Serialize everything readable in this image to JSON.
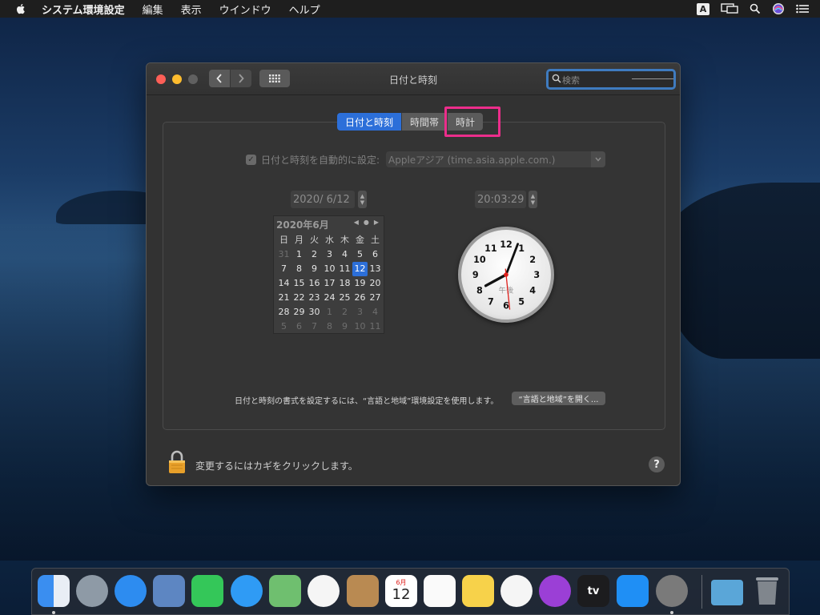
{
  "menubar": {
    "app_name": "システム環境設定",
    "items": [
      "編集",
      "表示",
      "ウインドウ",
      "ヘルプ"
    ],
    "input_indicator": "A"
  },
  "window": {
    "title": "日付と時刻",
    "search_placeholder": "検索",
    "tabs": [
      {
        "label": "日付と時刻",
        "active": true
      },
      {
        "label": "時間帯",
        "active": false
      },
      {
        "label": "時計",
        "active": false
      }
    ],
    "auto_set_label": "日付と時刻を自動的に設定:",
    "auto_set_checked": true,
    "time_server": "Appleアジア (time.asia.apple.com.)",
    "date_value": "2020/  6/12",
    "time_value": "20:03:29",
    "calendar": {
      "month_label": "2020年6月",
      "weekdays": [
        "日",
        "月",
        "火",
        "水",
        "木",
        "金",
        "土"
      ],
      "weeks": [
        [
          {
            "d": "31",
            "dim": true
          },
          {
            "d": "1"
          },
          {
            "d": "2"
          },
          {
            "d": "3"
          },
          {
            "d": "4"
          },
          {
            "d": "5"
          },
          {
            "d": "6"
          }
        ],
        [
          {
            "d": "7"
          },
          {
            "d": "8"
          },
          {
            "d": "9"
          },
          {
            "d": "10"
          },
          {
            "d": "11"
          },
          {
            "d": "12",
            "today": true
          },
          {
            "d": "13"
          }
        ],
        [
          {
            "d": "14"
          },
          {
            "d": "15"
          },
          {
            "d": "16"
          },
          {
            "d": "17"
          },
          {
            "d": "18"
          },
          {
            "d": "19"
          },
          {
            "d": "20"
          }
        ],
        [
          {
            "d": "21"
          },
          {
            "d": "22"
          },
          {
            "d": "23"
          },
          {
            "d": "24"
          },
          {
            "d": "25"
          },
          {
            "d": "26"
          },
          {
            "d": "27"
          }
        ],
        [
          {
            "d": "28"
          },
          {
            "d": "29"
          },
          {
            "d": "30"
          },
          {
            "d": "1",
            "dim": true
          },
          {
            "d": "2",
            "dim": true
          },
          {
            "d": "3",
            "dim": true
          },
          {
            "d": "4",
            "dim": true
          }
        ],
        [
          {
            "d": "5",
            "dim": true
          },
          {
            "d": "6",
            "dim": true
          },
          {
            "d": "7",
            "dim": true
          },
          {
            "d": "8",
            "dim": true
          },
          {
            "d": "9",
            "dim": true
          },
          {
            "d": "10",
            "dim": true
          },
          {
            "d": "11",
            "dim": true
          }
        ]
      ]
    },
    "clock": {
      "numerals": [
        "12",
        "1",
        "2",
        "3",
        "4",
        "5",
        "6",
        "7",
        "8",
        "9",
        "10",
        "11"
      ],
      "ampm_label": "午後",
      "hours": 20,
      "minutes": 3,
      "seconds": 29
    },
    "format_text": "日付と時刻の書式を設定するには、“言語と地域”環境設定を使用します。",
    "format_button": "“言語と地域”を開く...",
    "lock_text": "変更するにはカギをクリックします。",
    "help_label": "?"
  },
  "dock": {
    "apps": [
      {
        "icon": "finder-icon",
        "color": "#3a8ef0",
        "running": true
      },
      {
        "icon": "launchpad-icon",
        "color": "#8e9aa6",
        "running": false
      },
      {
        "icon": "safari-icon",
        "color": "#2d8cf0",
        "running": false
      },
      {
        "icon": "mail-icon",
        "color": "#5d86c2",
        "running": false
      },
      {
        "icon": "facetime-icon",
        "color": "#34c759",
        "running": false
      },
      {
        "icon": "messages-icon",
        "color": "#2f9bf5",
        "running": false
      },
      {
        "icon": "maps-icon",
        "color": "#6fbf6f",
        "running": false
      },
      {
        "icon": "photos-icon",
        "color": "#f5f5f5",
        "running": false
      },
      {
        "icon": "contacts-icon",
        "color": "#b98a52",
        "running": false
      },
      {
        "icon": "calendar-icon",
        "color": "#ffffff",
        "running": false,
        "month": "6月",
        "day": "12"
      },
      {
        "icon": "reminders-icon",
        "color": "#fafafa",
        "running": false
      },
      {
        "icon": "notes-icon",
        "color": "#f7d24a",
        "running": false
      },
      {
        "icon": "music-icon",
        "color": "#f5f5f5",
        "running": false
      },
      {
        "icon": "podcasts-icon",
        "color": "#9b3fd6",
        "running": false
      },
      {
        "icon": "appletv-icon",
        "color": "#1c1c1e",
        "running": false,
        "label": "tv"
      },
      {
        "icon": "appstore-icon",
        "color": "#1f8ff5",
        "running": false
      },
      {
        "icon": "system-preferences-icon",
        "color": "#7a7a7a",
        "running": true
      },
      {
        "icon": "downloads-folder-icon",
        "color": "#5aa6d8",
        "running": false
      },
      {
        "icon": "trash-icon",
        "color": "#8a8f96",
        "running": false
      }
    ]
  }
}
